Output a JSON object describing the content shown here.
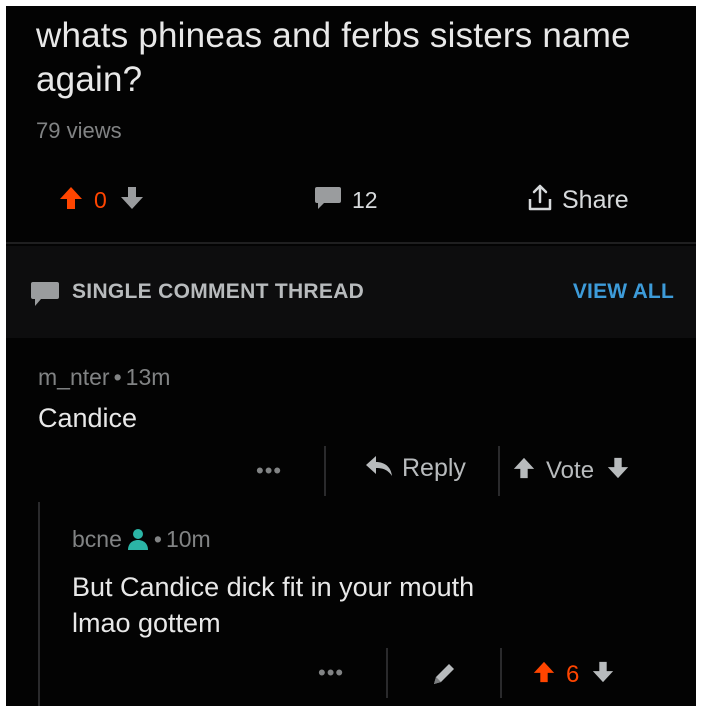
{
  "post": {
    "title": "whats phineas and ferbs sisters name again?",
    "views": "79 views",
    "score": "0",
    "comments_count": "12",
    "share_label": "Share"
  },
  "thread": {
    "label": "SINGLE COMMENT THREAD",
    "view_all": "VIEW ALL"
  },
  "comments": [
    {
      "author": "m_nter",
      "age": "13m",
      "body": "Candice",
      "more": "•••",
      "reply_label": "Reply",
      "vote_label": "Vote"
    },
    {
      "author": "bcne",
      "age": "10m",
      "body_line1": "But Candice dick fit in your mouth",
      "body_line2": "lmao gottem",
      "more": "•••",
      "score": "6"
    }
  ],
  "colors": {
    "upvote": "#ff4500",
    "link": "#3d9bd9",
    "mod_icon": "#2bb5a6"
  },
  "icons": [
    "upvote-arrow-icon",
    "downvote-arrow-icon",
    "comment-bubble-icon",
    "share-icon",
    "reply-arrow-icon",
    "pencil-icon",
    "user-icon"
  ]
}
